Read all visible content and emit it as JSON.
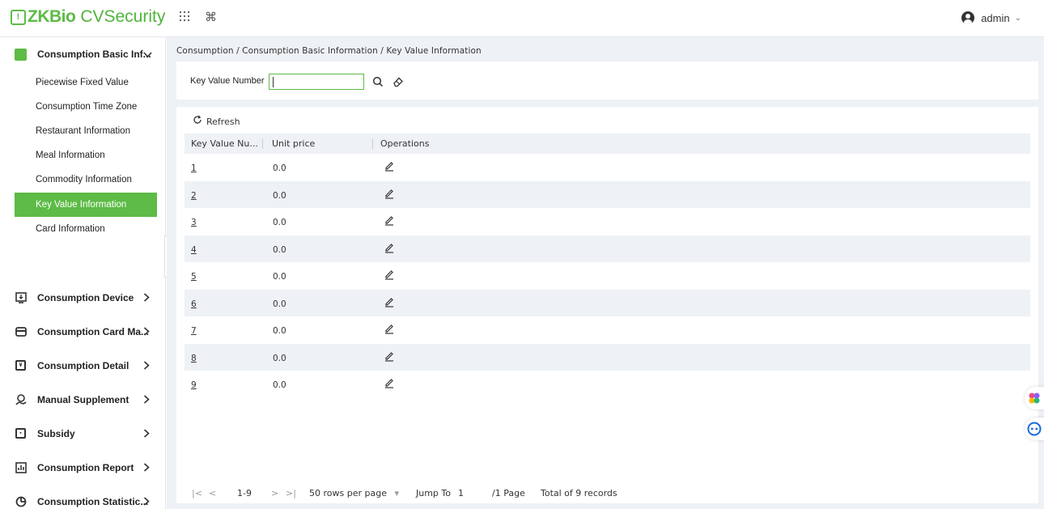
{
  "header": {
    "brand": "ZKBio",
    "product": "CVSecurity",
    "grid_icon": "grid-icon",
    "command_icon": "command-icon",
    "user": "admin"
  },
  "sidebar": {
    "open_menu": {
      "label": "Consumption Basic Inf...",
      "icon": "green-square-icon"
    },
    "items": [
      {
        "label": "Piecewise Fixed Value"
      },
      {
        "label": "Consumption Time Zone"
      },
      {
        "label": "Restaurant Information"
      },
      {
        "label": "Meal Information"
      },
      {
        "label": "Commodity Information"
      },
      {
        "label": "Key Value Information",
        "active": true
      },
      {
        "label": "Card Information"
      }
    ],
    "menus": [
      {
        "label": "Consumption Device",
        "icon": "device-icon"
      },
      {
        "label": "Consumption Card Ma...",
        "icon": "card-icon"
      },
      {
        "label": "Consumption Detail",
        "icon": "detail-icon"
      },
      {
        "label": "Manual Supplement",
        "icon": "supplement-icon"
      },
      {
        "label": "Subsidy",
        "icon": "subsidy-icon"
      },
      {
        "label": "Consumption Report",
        "icon": "report-icon"
      },
      {
        "label": "Consumption Statistic...",
        "icon": "statistic-icon"
      }
    ],
    "collapse_glyph": "«"
  },
  "breadcrumb": "Consumption / Consumption Basic Information / Key Value Information",
  "search": {
    "label": "Key Value Number",
    "value": ""
  },
  "toolbar": {
    "refresh": "Refresh"
  },
  "table": {
    "columns": [
      "Key Value Nu...",
      "Unit price",
      "Operations"
    ],
    "rows": [
      {
        "key": "1",
        "price": "0.0"
      },
      {
        "key": "2",
        "price": "0.0"
      },
      {
        "key": "3",
        "price": "0.0"
      },
      {
        "key": "4",
        "price": "0.0"
      },
      {
        "key": "5",
        "price": "0.0"
      },
      {
        "key": "6",
        "price": "0.0"
      },
      {
        "key": "7",
        "price": "0.0"
      },
      {
        "key": "8",
        "price": "0.0"
      },
      {
        "key": "9",
        "price": "0.0"
      }
    ]
  },
  "pager": {
    "first": "|<",
    "prev": "<",
    "range": "1-9",
    "next": ">",
    "last": ">|",
    "rows_per_page": "50 rows per page",
    "jump_label": "Jump To",
    "jump_value": "1",
    "pages": "/1 Page",
    "total": "Total of 9 records"
  },
  "colors": {
    "accent": "#5dbb46",
    "stripe": "#eef1f6"
  }
}
